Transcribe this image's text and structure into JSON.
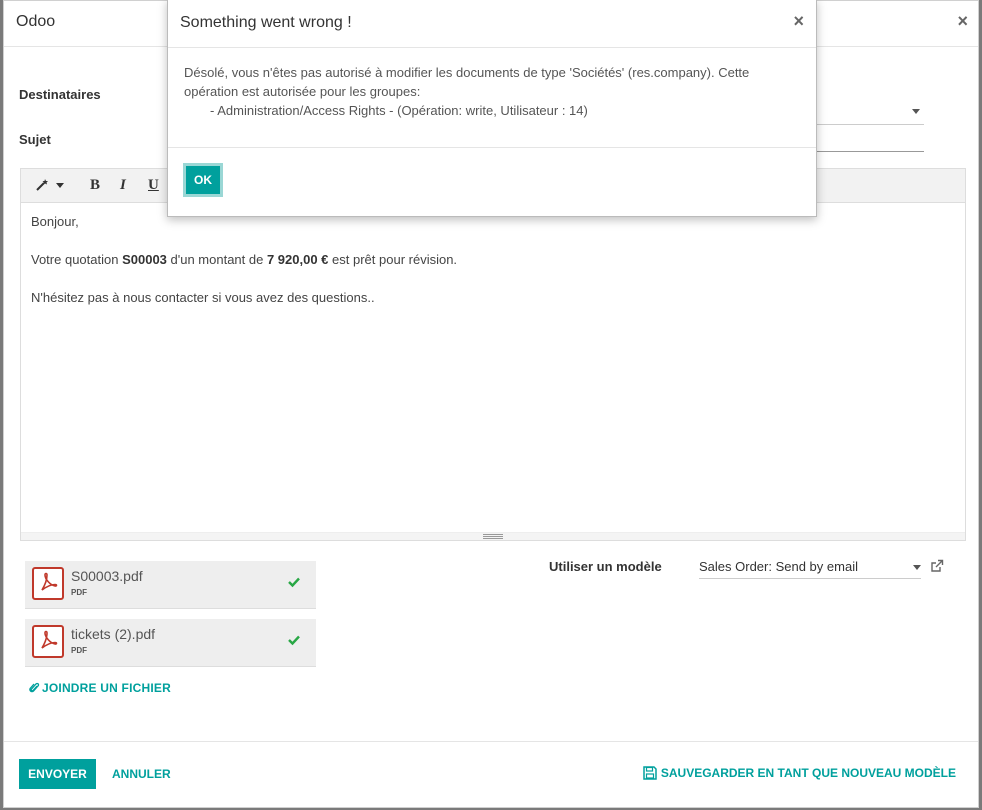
{
  "main_dialog": {
    "title": "Odoo",
    "close": "×",
    "recipients_label": "Destinataires",
    "subject_label": "Sujet",
    "editor": {
      "toolbar": {
        "bold": "B",
        "italic": "I",
        "underline": "U"
      },
      "greeting": "Bonjour,",
      "line2_prefix": "Votre quotation ",
      "quote_ref": "S00003",
      "line2_mid": " d'un montant de ",
      "amount": "7 920,00 €",
      "line2_suffix": " est prêt pour révision.",
      "line3": "N'hésitez pas à nous contacter si vous avez des questions.."
    },
    "attachments": [
      {
        "name": "S00003.pdf",
        "type": "PDF"
      },
      {
        "name": "tickets (2).pdf",
        "type": "PDF"
      }
    ],
    "attach_file_label": "JOINDRE UN FICHIER",
    "template_label": "Utiliser un modèle",
    "template_value": "Sales Order: Send by email",
    "footer": {
      "send": "ENVOYER",
      "cancel": "ANNULER",
      "save_template": "SAUVEGARDER EN TANT QUE NOUVEAU MODÈLE"
    }
  },
  "error_dialog": {
    "title": "Something went wrong !",
    "close": "×",
    "message_line1": "Désolé, vous n'êtes pas autorisé à modifier les documents de type 'Sociétés' (res.company). Cette opération est autorisée pour les groupes:",
    "message_line2": "- Administration/Access Rights - (Opération: write, Utilisateur : 14)",
    "ok": "OK"
  },
  "colors": {
    "accent": "#00a09d",
    "pdf_red": "#c0392b",
    "check_green": "#28a745"
  }
}
